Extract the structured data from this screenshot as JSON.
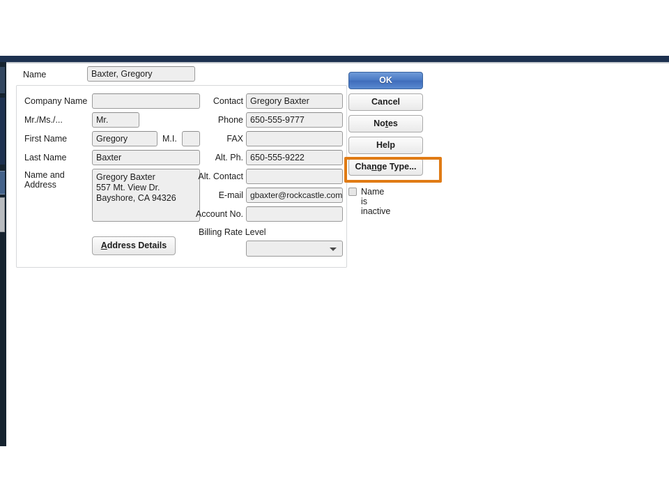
{
  "window": {
    "accent_navy": "#1d3150",
    "rail_navy": "#16232f",
    "highlight_orange": "#e07b15",
    "primary_blue": "#4a79c4"
  },
  "dialog": {
    "name_row": {
      "label": "Name",
      "value": "Baxter, Gregory"
    },
    "left_fields": [
      {
        "label": "Company Name",
        "value": ""
      },
      {
        "label": "Mr./Ms./...",
        "value": "Mr."
      },
      {
        "label": "First Name",
        "value": "Gregory"
      },
      {
        "label": "Last Name",
        "value": "Baxter"
      }
    ],
    "mi": {
      "label": "M.I.",
      "value": ""
    },
    "address": {
      "label_line1": "Name and",
      "label_line2": "Address",
      "lines": [
        "Gregory Baxter",
        "557 Mt. View Dr.",
        "Bayshore, CA 94326"
      ]
    },
    "address_details_button": {
      "accel": "A",
      "rest": "ddress Details"
    },
    "right_fields": [
      {
        "label": "Contact",
        "value": "Gregory Baxter"
      },
      {
        "label": "Phone",
        "value": "650-555-9777"
      },
      {
        "label": "FAX",
        "value": ""
      },
      {
        "label": "Alt. Ph.",
        "value": "650-555-9222"
      },
      {
        "label": "Alt. Contact",
        "value": ""
      },
      {
        "label": "E-mail",
        "value": "gbaxter@rockcastle.com"
      },
      {
        "label": "Account No.",
        "value": ""
      }
    ],
    "billing_rate_level": {
      "label": "Billing Rate Level",
      "value": ""
    }
  },
  "buttons": {
    "ok": {
      "label": "OK"
    },
    "cancel": {
      "label": "Cancel"
    },
    "notes": {
      "pre": "No",
      "accel": "t",
      "post": "es"
    },
    "help": {
      "label": "Help"
    },
    "change_type": {
      "pre": "Cha",
      "accel": "n",
      "post": "ge Type..."
    }
  },
  "inactive": {
    "label": "Name is inactive",
    "checked": false
  }
}
